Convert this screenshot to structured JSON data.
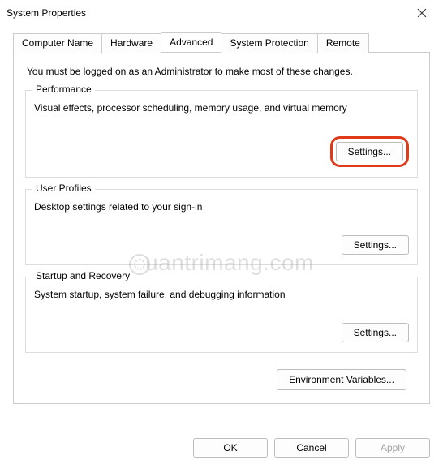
{
  "window": {
    "title": "System Properties"
  },
  "tabs": {
    "items": [
      {
        "label": "Computer Name"
      },
      {
        "label": "Hardware"
      },
      {
        "label": "Advanced"
      },
      {
        "label": "System Protection"
      },
      {
        "label": "Remote"
      }
    ],
    "active_index": 2
  },
  "intro": "You must be logged on as an Administrator to make most of these changes.",
  "groups": {
    "performance": {
      "title": "Performance",
      "desc": "Visual effects, processor scheduling, memory usage, and virtual memory",
      "button": "Settings..."
    },
    "user_profiles": {
      "title": "User Profiles",
      "desc": "Desktop settings related to your sign-in",
      "button": "Settings..."
    },
    "startup": {
      "title": "Startup and Recovery",
      "desc": "System startup, system failure, and debugging information",
      "button": "Settings..."
    }
  },
  "env_button": "Environment Variables...",
  "buttons": {
    "ok": "OK",
    "cancel": "Cancel",
    "apply": "Apply"
  },
  "watermark": "uantrimang.com"
}
